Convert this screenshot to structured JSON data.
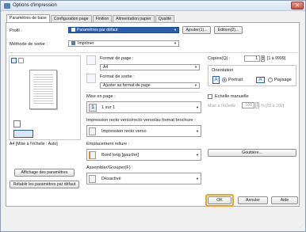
{
  "window": {
    "title": "Options d'impression",
    "close_glyph": "✕"
  },
  "tabs": [
    {
      "label": "Paramètres de base",
      "active": true
    },
    {
      "label": "Configuration page",
      "active": false
    },
    {
      "label": "Finition",
      "active": false
    },
    {
      "label": "Alimentation papier",
      "active": false
    },
    {
      "label": "Qualité",
      "active": false
    }
  ],
  "profile": {
    "label": "Profil :",
    "value": "Paramètres par défaut",
    "add_button": "Ajouter(1)...",
    "edit_button": "Edition(2)..."
  },
  "output_method": {
    "label": "Méthode de sortie :",
    "value": "Imprimer"
  },
  "preview": {
    "caption": "A4 [Mise à l'échelle : Auto]"
  },
  "left_buttons": {
    "show_settings": "Affichage des paramètres",
    "restore_defaults": "Rétablir les paramètres par défaut"
  },
  "page_format": {
    "label": "Format de page :",
    "value": "A4"
  },
  "output_format": {
    "label": "Format de sortie :",
    "value": "Ajuster au format de page"
  },
  "copies": {
    "label": "Copies(Q) :",
    "value": "1",
    "range": "[1 à 9999]"
  },
  "orientation": {
    "label": "Orientation",
    "portrait": "Portrait",
    "landscape": "Paysage",
    "selected": "portrait"
  },
  "layout": {
    "label": "Mise en page :",
    "value": "1 sur 1"
  },
  "manual_scaling": {
    "label": "Echelle manuelle",
    "checked": false
  },
  "scaling": {
    "label": "Mise à l'échelle :",
    "value": "100",
    "range": "% [25 à 200]"
  },
  "duplex": {
    "label": "Impression recto verso/recto verso/au format brochure :",
    "value": "Impression recto verso"
  },
  "binding": {
    "label": "Emplacement reliure :",
    "value": "Bord long [gauche]"
  },
  "gutter_button": "Gouttière...",
  "collate": {
    "label": "Assembler/Grouper(F) :",
    "value": "Désactivé"
  },
  "footer": {
    "ok": "OK",
    "cancel": "Annuler",
    "help": "Aide"
  },
  "colors": {
    "accent": "#2a5db0",
    "highlight": "#f0a020",
    "titlebar": "#d6e4f5"
  }
}
